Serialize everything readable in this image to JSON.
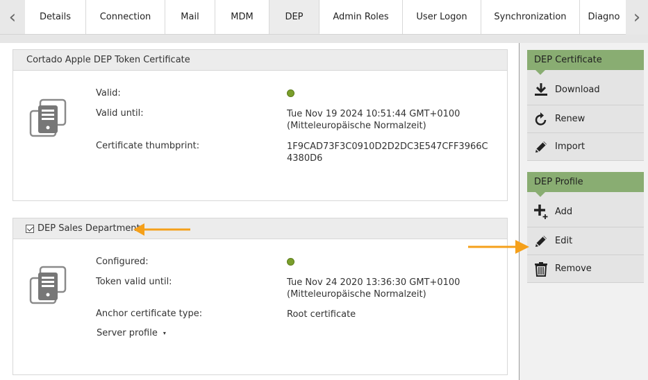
{
  "tabs": [
    {
      "label": "Details",
      "width": 88
    },
    {
      "label": "Connection",
      "width": 114
    },
    {
      "label": "Mail",
      "width": 72
    },
    {
      "label": "MDM",
      "width": 78
    },
    {
      "label": "DEP",
      "width": 72,
      "active": true
    },
    {
      "label": "Admin Roles",
      "width": 120
    },
    {
      "label": "User Logon",
      "width": 113
    },
    {
      "label": "Synchronization",
      "width": 142
    },
    {
      "label": "Diagno",
      "width": 70
    }
  ],
  "tab_nav": {
    "prev_glyph": "‹",
    "next_glyph": "›"
  },
  "certificate_panel": {
    "title": "Cortado Apple DEP Token Certificate",
    "valid_label": "Valid:",
    "valid_until_label": "Valid until:",
    "valid_until_line1": "Tue Nov 19 2024 10:51:44 GMT+0100",
    "valid_until_line2": "(Mitteleuropäische Normalzeit)",
    "thumbprint_label": "Certificate thumbprint:",
    "thumbprint_line1": "1F9CAD73F3C0910D2D2DC3E547CFF3966C",
    "thumbprint_line2": "4380D6",
    "status_color": "#7a9e2b"
  },
  "profile_panel": {
    "title": "DEP Sales Department",
    "checked": true,
    "configured_label": "Configured:",
    "token_valid_label": "Token valid until:",
    "token_valid_line1": "Tue Nov 24 2020 13:36:30 GMT+0100",
    "token_valid_line2": "(Mitteleuropäische Normalzeit)",
    "anchor_label": "Anchor certificate type:",
    "anchor_value": "Root certificate",
    "server_profile_label": "Server profile",
    "server_profile_caret": "▾"
  },
  "sidebar": {
    "certificate_header": "DEP Certificate",
    "certificate_actions": [
      "Download",
      "Renew",
      "Import"
    ],
    "profile_header": "DEP Profile",
    "profile_actions": [
      "Add",
      "Edit",
      "Remove"
    ]
  },
  "colors": {
    "accent_green": "#89ad72",
    "annotation_orange": "#f5a01a",
    "status_green": "#7a9e2b"
  }
}
